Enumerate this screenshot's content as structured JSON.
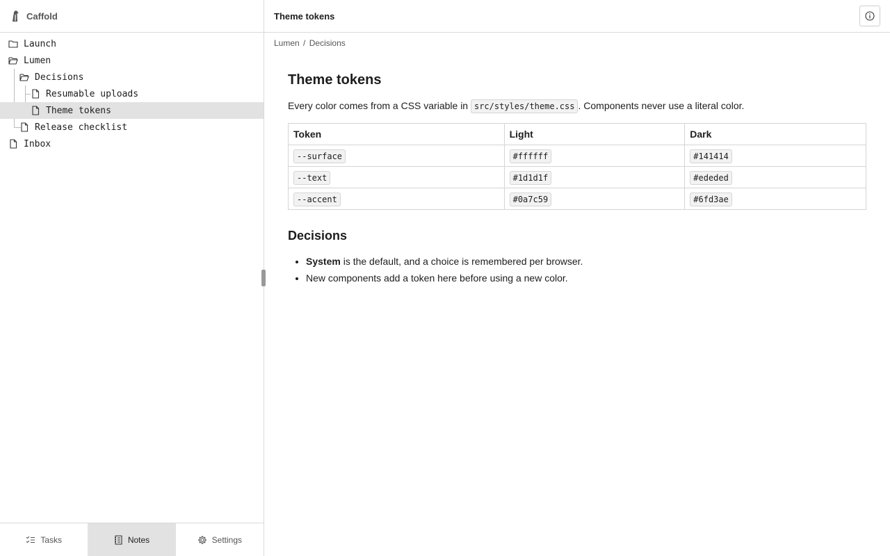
{
  "app": {
    "name": "Caffold"
  },
  "tree": {
    "items": [
      {
        "label": "Launch",
        "icon": "folder-icon"
      },
      {
        "label": "Lumen",
        "icon": "folder-open-icon"
      },
      {
        "label": "Decisions",
        "icon": "folder-open-icon"
      },
      {
        "label": "Resumable uploads",
        "icon": "file-icon"
      },
      {
        "label": "Theme tokens",
        "icon": "file-icon",
        "selected": true
      },
      {
        "label": "Release checklist",
        "icon": "file-icon"
      },
      {
        "label": "Inbox",
        "icon": "file-icon"
      }
    ]
  },
  "bottom_tabs": [
    {
      "label": "Tasks",
      "icon": "tasks-icon"
    },
    {
      "label": "Notes",
      "icon": "notes-icon",
      "active": true
    },
    {
      "label": "Settings",
      "icon": "gear-icon"
    }
  ],
  "main": {
    "title": "Theme tokens",
    "breadcrumb": {
      "parent": "Lumen",
      "separator": "/",
      "current": "Decisions"
    },
    "doc": {
      "heading": "Theme tokens",
      "intro_before": "Every color comes from a CSS variable in ",
      "intro_code": "src/styles/theme.css",
      "intro_after": ". Components never use a literal color.",
      "table": {
        "headers": [
          "Token",
          "Light",
          "Dark"
        ],
        "rows": [
          [
            "--surface",
            "#ffffff",
            "#141414"
          ],
          [
            "--text",
            "#1d1d1f",
            "#ededed"
          ],
          [
            "--accent",
            "#0a7c59",
            "#6fd3ae"
          ]
        ]
      },
      "decisions_heading": "Decisions",
      "bullets": {
        "b1_bold": "System",
        "b1_rest": " is the default, and a choice is remembered per browser.",
        "b2": "New components add a token here before using a new color."
      }
    }
  },
  "colors": {
    "border": "#d9d9d9",
    "selected": "#e2e2e2",
    "text": "#1d1d1f"
  }
}
